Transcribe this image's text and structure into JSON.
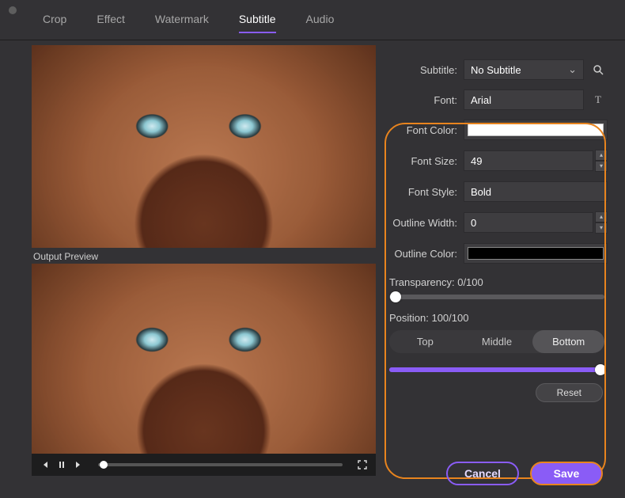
{
  "tabs": {
    "crop": "Crop",
    "effect": "Effect",
    "watermark": "Watermark",
    "subtitle": "Subtitle",
    "audio": "Audio"
  },
  "output_preview_label": "Output Preview",
  "subtitle_panel": {
    "subtitle_label": "Subtitle:",
    "subtitle_value": "No Subtitle",
    "font_label": "Font:",
    "font_value": "Arial",
    "font_color_label": "Font Color:",
    "font_color_value": "#FFFFFF",
    "font_size_label": "Font Size:",
    "font_size_value": "49",
    "font_style_label": "Font Style:",
    "font_style_value": "Bold",
    "outline_width_label": "Outline Width:",
    "outline_width_value": "0",
    "outline_color_label": "Outline Color:",
    "outline_color_value": "#000000",
    "transparency_label": "Transparency: 0/100",
    "transparency_value": 0,
    "position_label": "Position: 100/100",
    "position_value": 100,
    "pos_top": "Top",
    "pos_middle": "Middle",
    "pos_bottom": "Bottom",
    "reset_label": "Reset"
  },
  "actions": {
    "cancel": "Cancel",
    "save": "Save"
  }
}
